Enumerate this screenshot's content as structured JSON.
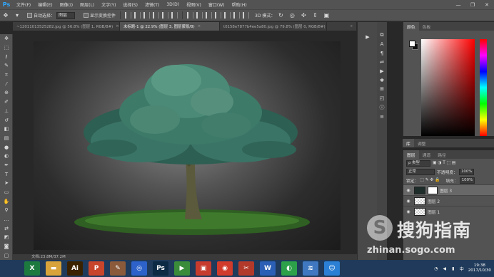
{
  "app": {
    "logo": "Ps"
  },
  "menu": [
    "文件(F)",
    "编辑(E)",
    "图像(I)",
    "图层(L)",
    "文字(Y)",
    "选择(S)",
    "滤镜(T)",
    "3D(D)",
    "视图(V)",
    "窗口(W)",
    "帮助(H)"
  ],
  "window_controls": {
    "minimize": "—",
    "maximize": "❐",
    "close": "✕"
  },
  "options": {
    "auto_select_label": "自动选择：",
    "auto_select_value": "图层",
    "show_transform_label": "显示变换控件",
    "mode_3d_label": "3D 模式："
  },
  "tabs": [
    {
      "label": "~12011013525282.jpg @ 56.8% (图层 1, RGB/8#)",
      "active": false
    },
    {
      "label": "未标题-1 @ 22.9% (图层 3, 图层蒙版/8)",
      "active": true
    },
    {
      "label": "t0158e7877b4ee5a80.jpg @ 79.8% (图层 0, RGB/8#)",
      "active": false
    }
  ],
  "status": {
    "doc_info": "文档:23.8M/37.2M"
  },
  "color_panel": {
    "tabs": [
      "颜色",
      "色板"
    ]
  },
  "lib_panel": {
    "tabs": [
      "库",
      "调整"
    ]
  },
  "layers_panel": {
    "tabs": [
      "图层",
      "通道",
      "路径"
    ],
    "filter_value": "ρ 类型",
    "blend_mode": "正常",
    "opacity_label": "不透明度：",
    "opacity_value": "100%",
    "lock_label": "锁定：",
    "fill_label": "填充：",
    "fill_value": "100%",
    "layers": [
      {
        "name": "图层 3",
        "selected": true,
        "has_mask": true
      },
      {
        "name": "图层 2",
        "selected": false,
        "has_mask": false
      },
      {
        "name": "图层 1",
        "selected": false,
        "has_mask": false
      }
    ]
  },
  "watermark": {
    "logo_char": "S",
    "text": "搜狗指南",
    "url": "zhinan.sogo.com"
  },
  "taskbar": {
    "apps": [
      {
        "icon": "excel-icon",
        "glyph": "X",
        "color": "#1d7a3f"
      },
      {
        "icon": "folder-icon",
        "glyph": "▬",
        "color": "#d8a33a"
      },
      {
        "icon": "illustrator-icon",
        "glyph": "Ai",
        "color": "#3a2200"
      },
      {
        "icon": "powerpoint-icon",
        "glyph": "P",
        "color": "#c8452b"
      },
      {
        "icon": "paint-icon",
        "glyph": "✎",
        "color": "#8a5a3a"
      },
      {
        "icon": "baidu-icon",
        "glyph": "◎",
        "color": "#2c62c9"
      },
      {
        "icon": "photoshop-icon",
        "glyph": "Ps",
        "color": "#0c2a44"
      },
      {
        "icon": "player-icon",
        "glyph": "▶",
        "color": "#3a8c3a"
      },
      {
        "icon": "video-icon",
        "glyph": "▣",
        "color": "#c63b2d"
      },
      {
        "icon": "media-icon",
        "glyph": "◉",
        "color": "#d13b2b"
      },
      {
        "icon": "tool-icon",
        "glyph": "✂",
        "color": "#b33a2b"
      },
      {
        "icon": "word-icon",
        "glyph": "W",
        "color": "#2b5fb5"
      },
      {
        "icon": "browser-icon",
        "glyph": "◐",
        "color": "#2da04a"
      },
      {
        "icon": "chart-icon",
        "glyph": "≋",
        "color": "#3f78c0"
      },
      {
        "icon": "qq-icon",
        "glyph": "☺",
        "color": "#2b7fd4"
      }
    ],
    "lang": "中",
    "time": "19:38",
    "date": "2017/10/30"
  }
}
